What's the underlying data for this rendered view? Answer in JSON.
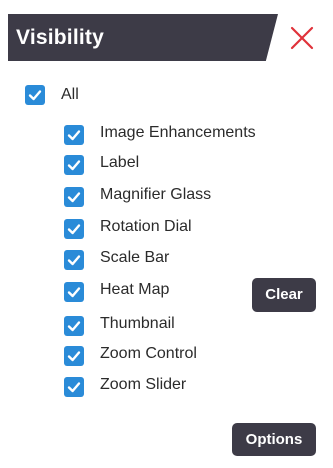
{
  "panel": {
    "title": "Visibility",
    "close_icon": "close-icon",
    "accent_color": "#2a8bd8",
    "header_color": "#3d3b47",
    "close_color": "#e0323a"
  },
  "all_option": {
    "label": "All",
    "checked": true
  },
  "items": [
    {
      "label": "Image Enhancements",
      "checked": true
    },
    {
      "label": "Label",
      "checked": true
    },
    {
      "label": "Magnifier Glass",
      "checked": true
    },
    {
      "label": "Rotation Dial",
      "checked": true
    },
    {
      "label": "Scale Bar",
      "checked": true
    },
    {
      "label": "Heat Map",
      "checked": true
    },
    {
      "label": "Thumbnail",
      "checked": true
    },
    {
      "label": "Zoom Control",
      "checked": true
    },
    {
      "label": "Zoom Slider",
      "checked": true
    }
  ],
  "buttons": {
    "clear_label": "Clear",
    "options_label": "Options"
  }
}
